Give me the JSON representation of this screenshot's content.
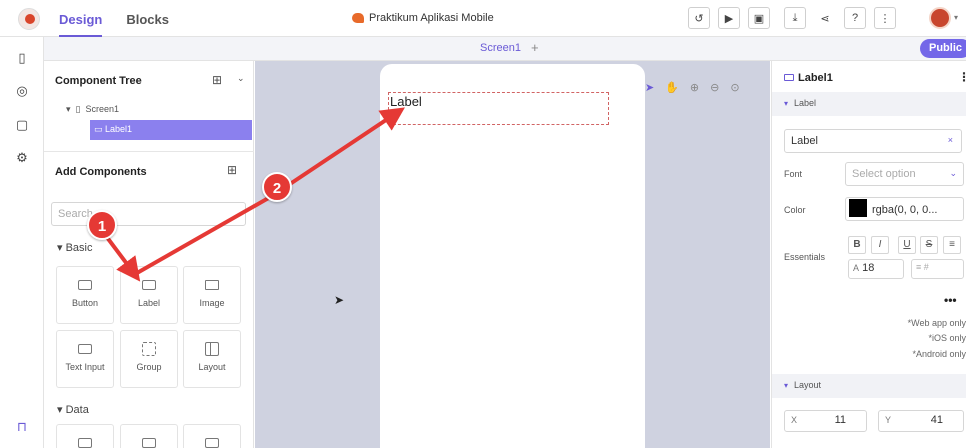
{
  "topbar": {
    "tabs": [
      {
        "label": "Design"
      },
      {
        "label": "Blocks"
      }
    ],
    "project_name": "Praktikum Aplikasi Mobile",
    "icons": [
      "history-icon",
      "play-preview-icon",
      "device-preview-icon",
      "export-icon",
      "share-icon",
      "help-icon",
      "more-icon"
    ],
    "help_glyph": "?",
    "more_glyph": "⋮"
  },
  "rail": {
    "items": [
      "screens-icon",
      "database-icon",
      "assets-icon",
      "settings-icon",
      "lock-icon"
    ]
  },
  "screenbar": {
    "screen_name": "Screen1",
    "add_glyph": "+",
    "public_label": "Public"
  },
  "left": {
    "tree_title": "Component Tree",
    "tree_root": "Screen1",
    "tree_child": "Label1",
    "add_title": "Add Components",
    "search_placeholder": "Search",
    "section_basic": "Basic",
    "section_data": "Data",
    "components": [
      "Button",
      "Label",
      "Image",
      "Text Input",
      "Group",
      "Layout"
    ]
  },
  "canvas": {
    "label_text": "Label"
  },
  "right": {
    "component_name": "Label1",
    "section_label": "Label",
    "text_value": "Label",
    "font_label": "Font",
    "font_placeholder": "Select option",
    "color_label": "Color",
    "color_value": "rgba(0, 0, 0...",
    "essentials_label": "Essentials",
    "font_size": "18",
    "notes": [
      "*Web app only",
      "*iOS only",
      "*Android only"
    ],
    "section_layout": "Layout",
    "x_label": "X",
    "x_value": "11",
    "y_label": "Y",
    "y_value": "41"
  },
  "annotations": {
    "badge_1": "1",
    "badge_2": "2",
    "arrow_color": "#e53935"
  },
  "colors": {
    "accent": "#6a5ad6",
    "public": "#7367e8",
    "canvas_bg": "#cfd2e0"
  }
}
